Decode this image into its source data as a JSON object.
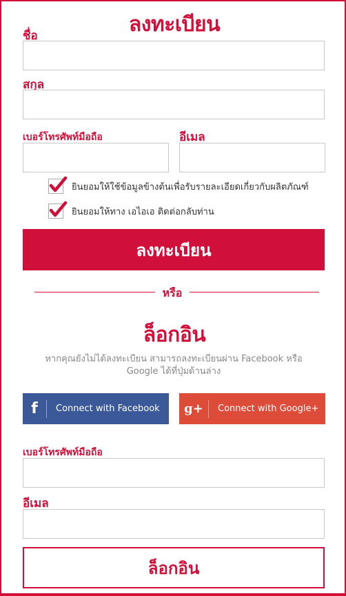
{
  "register": {
    "title": "ลงทะเบียน",
    "first_name_label": "ชื่อ",
    "first_name_value": "",
    "last_name_label": "สกุล",
    "last_name_value": "",
    "phone_label": "เบอร์โทรศัพท์มือถือ",
    "phone_value": "",
    "email_label": "อีเมล",
    "email_value": "",
    "consent_product_info": "ยินยอมให้ใช้ข้อมูลข้างต้นเพื่อรับรายละเอียดเกี่ยวกับผลิตภัณฑ์",
    "consent_product_info_checked": true,
    "consent_contact": "ยินยอมให้ทาง เอไอเอ ติดต่อกลับท่าน",
    "consent_contact_checked": true,
    "submit_label": "ลงทะเบียน"
  },
  "divider": {
    "or_label": "หรือ"
  },
  "login": {
    "title": "ล็อกอิน",
    "instruction": "หากคุณยังไม่ได้ลงทะเบียน สามารถลงทะเบียนผ่าน Facebook หรือ Google ได้ที่ปุ่มด้านล่าง",
    "facebook_label": "Connect with Facebook",
    "facebook_icon": "f",
    "google_label": "Connect with Google+",
    "google_icon": "g+",
    "phone_label": "เบอร์โทรศัพท์มือถือ",
    "phone_value": "",
    "email_label": "อีเมล",
    "email_value": "",
    "submit_label": "ล็อกอิน"
  },
  "colors": {
    "brand": "#d0103a",
    "facebook": "#3b5998",
    "google": "#dd4b39"
  }
}
